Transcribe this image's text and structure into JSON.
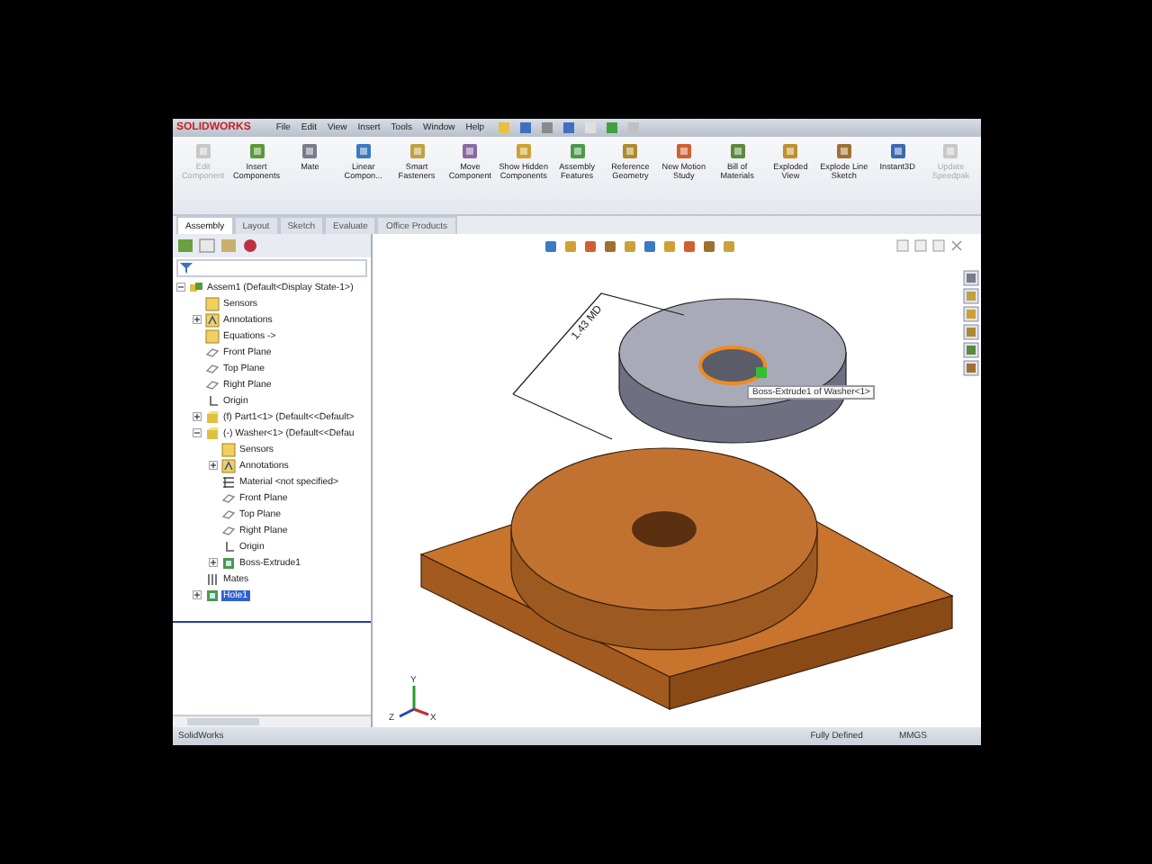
{
  "menu_bar": {
    "logo": "SOLIDWORKS",
    "items": [
      "File",
      "Edit",
      "View",
      "Insert",
      "Tools",
      "Window",
      "Help"
    ]
  },
  "ribbon": [
    {
      "label": "Edit Component",
      "disabled": true
    },
    {
      "label": "Insert Components",
      "disabled": false
    },
    {
      "label": "Mate",
      "disabled": false
    },
    {
      "label": "Linear Compon...",
      "disabled": false
    },
    {
      "label": "Smart Fasteners",
      "disabled": false
    },
    {
      "label": "Move Component",
      "disabled": false
    },
    {
      "label": "Show Hidden Components",
      "disabled": false
    },
    {
      "label": "Assembly Features",
      "disabled": false
    },
    {
      "label": "Reference Geometry",
      "disabled": false
    },
    {
      "label": "New Motion Study",
      "disabled": false
    },
    {
      "label": "Bill of Materials",
      "disabled": false
    },
    {
      "label": "Exploded View",
      "disabled": false
    },
    {
      "label": "Explode Line Sketch",
      "disabled": false
    },
    {
      "label": "Instant3D",
      "disabled": false
    },
    {
      "label": "Update Speedpak",
      "disabled": true
    }
  ],
  "tabs": [
    {
      "label": "Assembly",
      "selected": true
    },
    {
      "label": "Layout",
      "selected": false
    },
    {
      "label": "Sketch",
      "selected": false
    },
    {
      "label": "Evaluate",
      "selected": false
    },
    {
      "label": "Office Products",
      "selected": false
    }
  ],
  "tree": [
    {
      "label": "Assem1  (Default<Display State-1>)",
      "kind": "assembly",
      "selected": false,
      "expanded": true,
      "children": [
        {
          "label": "Sensors",
          "kind": "folder",
          "selected": false
        },
        {
          "label": "Annotations",
          "kind": "annotation",
          "selected": false,
          "expanded": false
        },
        {
          "label": "Equations ->",
          "kind": "folder",
          "selected": false
        },
        {
          "label": "Front Plane",
          "kind": "plane",
          "selected": false
        },
        {
          "label": "Top Plane",
          "kind": "plane",
          "selected": false
        },
        {
          "label": "Right Plane",
          "kind": "plane",
          "selected": false
        },
        {
          "label": "Origin",
          "kind": "origin",
          "selected": false
        },
        {
          "label": "(f) Part1<1> (Default<<Default>",
          "kind": "part",
          "selected": false,
          "expanded": false
        },
        {
          "label": "(-) Washer<1> (Default<<Defau",
          "kind": "part",
          "selected": false,
          "expanded": true,
          "children": [
            {
              "label": "Sensors",
              "kind": "folder",
              "selected": false
            },
            {
              "label": "Annotations",
              "kind": "annotation",
              "selected": false,
              "expanded": false
            },
            {
              "label": "Material <not specified>",
              "kind": "material",
              "selected": false
            },
            {
              "label": "Front Plane",
              "kind": "plane",
              "selected": false
            },
            {
              "label": "Top Plane",
              "kind": "plane",
              "selected": false
            },
            {
              "label": "Right Plane",
              "kind": "plane",
              "selected": false
            },
            {
              "label": "Origin",
              "kind": "origin",
              "selected": false
            },
            {
              "label": "Boss-Extrude1",
              "kind": "feature",
              "selected": false,
              "expanded": false
            }
          ]
        },
        {
          "label": "Mates",
          "kind": "mates",
          "selected": false
        },
        {
          "label": "Hole1",
          "kind": "feature",
          "selected": true,
          "expanded": false
        }
      ]
    }
  ],
  "graphics": {
    "dimension": "1.43 MD",
    "tooltip": "Boss-Extrude1 of Washer<1>",
    "axes": [
      "Y",
      "Z",
      "X"
    ]
  },
  "status_bar": {
    "app": "SolidWorks",
    "state": "Fully Defined",
    "units": "MMGS"
  }
}
